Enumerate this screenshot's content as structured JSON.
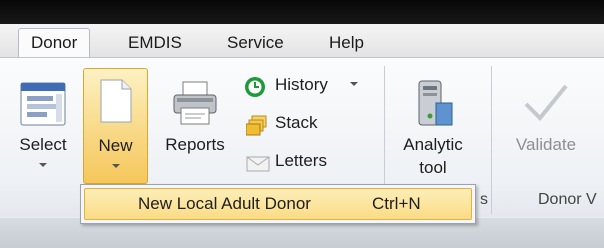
{
  "menu_tabs": [
    {
      "label": "Donor",
      "active": true
    },
    {
      "label": "EMDIS",
      "active": false
    },
    {
      "label": "Service",
      "active": false
    },
    {
      "label": "Help",
      "active": false
    }
  ],
  "ribbon": {
    "select_label": "Select",
    "new_label": "New",
    "reports_label": "Reports",
    "history_label": "History",
    "stack_label": "Stack",
    "letters_label": "Letters",
    "analytic_label_1": "Analytic",
    "analytic_label_2": "tool",
    "validate_label": "Validate",
    "group_label_partial": "s",
    "group_label_donor": "Donor V"
  },
  "new_menu": {
    "item_label": "New Local Adult Donor",
    "item_shortcut": "Ctrl+N"
  },
  "colors": {
    "highlight": "#f8d987",
    "highlight_border": "#d9a832",
    "titlebar": "#0b0b0b"
  }
}
